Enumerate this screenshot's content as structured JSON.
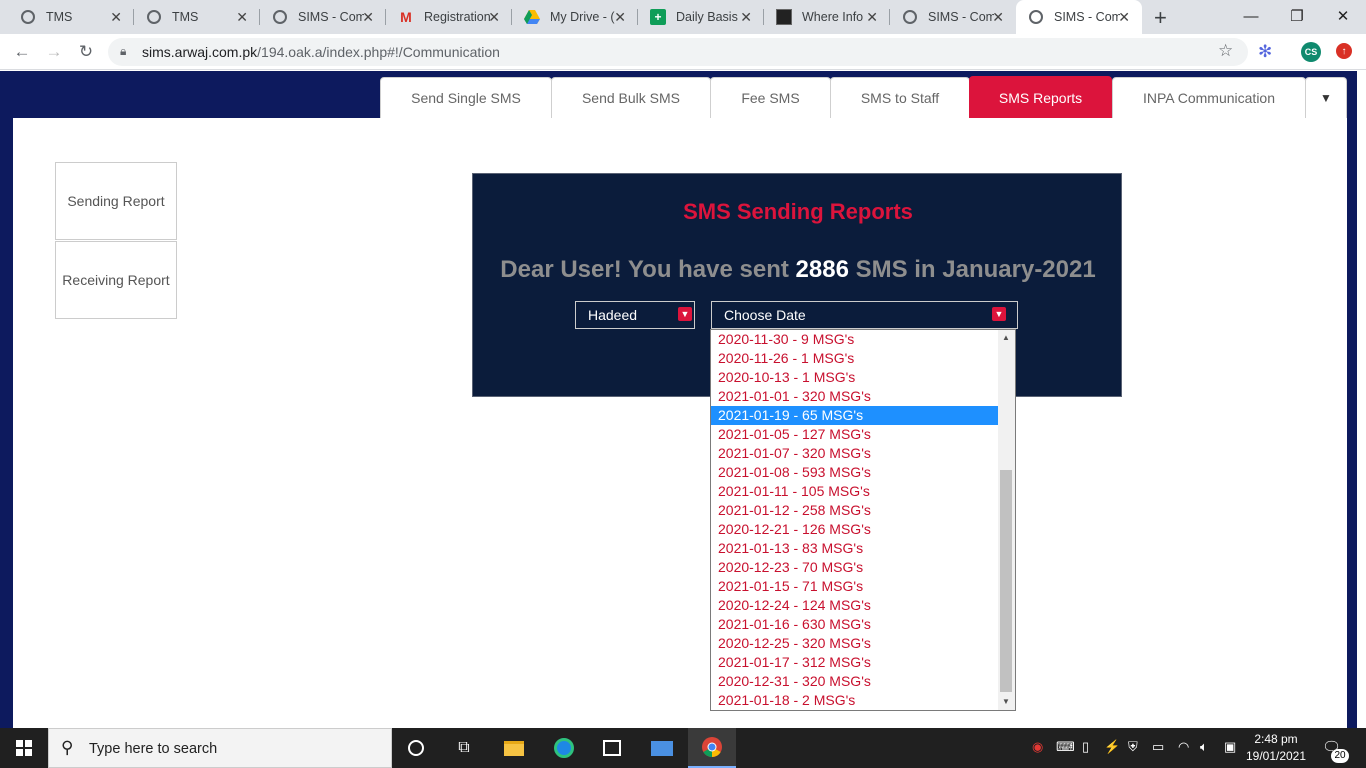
{
  "browser": {
    "tabs": [
      {
        "title": "TMS",
        "icon": "globe-icon"
      },
      {
        "title": "TMS",
        "icon": "globe-icon"
      },
      {
        "title": "SIMS - Com",
        "icon": "globe-icon"
      },
      {
        "title": "Registration",
        "icon": "gmail-icon"
      },
      {
        "title": "My Drive - (",
        "icon": "drive-icon"
      },
      {
        "title": "Daily Basis",
        "icon": "sheets-icon"
      },
      {
        "title": "Where Info",
        "icon": "image-icon"
      },
      {
        "title": "SIMS - Com",
        "icon": "globe-icon"
      },
      {
        "title": "SIMS - Com",
        "icon": "globe-icon"
      }
    ],
    "url_host": "sims.arwaj.com.pk",
    "url_path": "/194.oak.a/index.php#!/Communication",
    "profile_initials": "CS"
  },
  "nav_tabs": [
    "Send Single SMS",
    "Send Bulk SMS",
    "Fee SMS",
    "SMS to Staff",
    "SMS Reports",
    "INPA Communication"
  ],
  "sidebar": {
    "sending": "Sending Report",
    "receiving": "Receiving Report"
  },
  "panel": {
    "title": "SMS Sending Reports",
    "msg_prefix": "Dear User! You have sent ",
    "msg_count": "2886",
    "msg_suffix": " SMS in January-2021",
    "user_select": "Hadeed",
    "date_select": "Choose Date"
  },
  "dropdown": {
    "selected_index": 4,
    "options": [
      "2020-11-30 - 9 MSG's",
      "2020-11-26 - 1 MSG's",
      "2020-10-13 - 1 MSG's",
      "2021-01-01 - 320 MSG's",
      "2021-01-19 - 65 MSG's",
      "2021-01-05 - 127 MSG's",
      "2021-01-07 - 320 MSG's",
      "2021-01-08 - 593 MSG's",
      "2021-01-11 - 105 MSG's",
      "2021-01-12 - 258 MSG's",
      "2020-12-21 - 126 MSG's",
      "2021-01-13 - 83 MSG's",
      "2020-12-23 - 70 MSG's",
      "2021-01-15 - 71 MSG's",
      "2020-12-24 - 124 MSG's",
      "2021-01-16 - 630 MSG's",
      "2020-12-25 - 320 MSG's",
      "2021-01-17 - 312 MSG's",
      "2020-12-31 - 320 MSG's",
      "2021-01-18 - 2 MSG's"
    ]
  },
  "taskbar": {
    "search_placeholder": "Type here to search",
    "time": "2:48 pm",
    "date": "19/01/2021",
    "notifications": "20"
  },
  "colors": {
    "accent": "#dc143c",
    "panel_bg": "#0b1c3b",
    "page_bg": "#0d1a5e",
    "selected_option": "#1e90ff"
  }
}
